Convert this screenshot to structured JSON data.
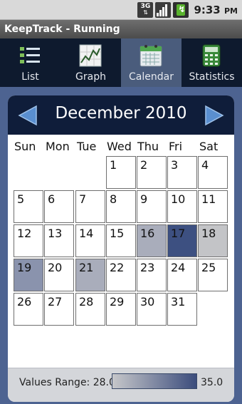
{
  "status_bar": {
    "network_label": "3G",
    "time": "9:33",
    "meridiem": "PM",
    "icons": [
      "network-3g-icon",
      "signal-strength-icon",
      "battery-charging-icon"
    ]
  },
  "app": {
    "title": "KeepTrack - Running"
  },
  "tabs": [
    {
      "label": "List",
      "icon": "list-icon",
      "active": false
    },
    {
      "label": "Graph",
      "icon": "graph-icon",
      "active": false
    },
    {
      "label": "Calendar",
      "icon": "calendar-icon",
      "active": true
    },
    {
      "label": "Statistics",
      "icon": "calculator-icon",
      "active": false
    }
  ],
  "calendar": {
    "month_title": "December 2010",
    "weekdays": [
      "Sun",
      "Mon",
      "Tue",
      "Wed",
      "Thu",
      "Fri",
      "Sat"
    ],
    "first_weekday_index": 3,
    "days_in_month": 31,
    "highlighted_days": [
      {
        "day": 16,
        "color": "#a9adbb"
      },
      {
        "day": 17,
        "color": "#3d5081"
      },
      {
        "day": 18,
        "color": "#c3c4c7"
      },
      {
        "day": 19,
        "color": "#8a93ad"
      },
      {
        "day": 21,
        "color": "#a9adbb"
      }
    ]
  },
  "values_range": {
    "label": "Values Range: 28.0",
    "max": "35.0",
    "min_color": "#c6c7ca",
    "max_color": "#3b4c7c"
  },
  "colors": {
    "header_bg": "#0f1d3a",
    "tab_active_bg": "#4a5c7c",
    "content_bg": "#4d6391",
    "arrow_color": "#5a8fd0"
  }
}
